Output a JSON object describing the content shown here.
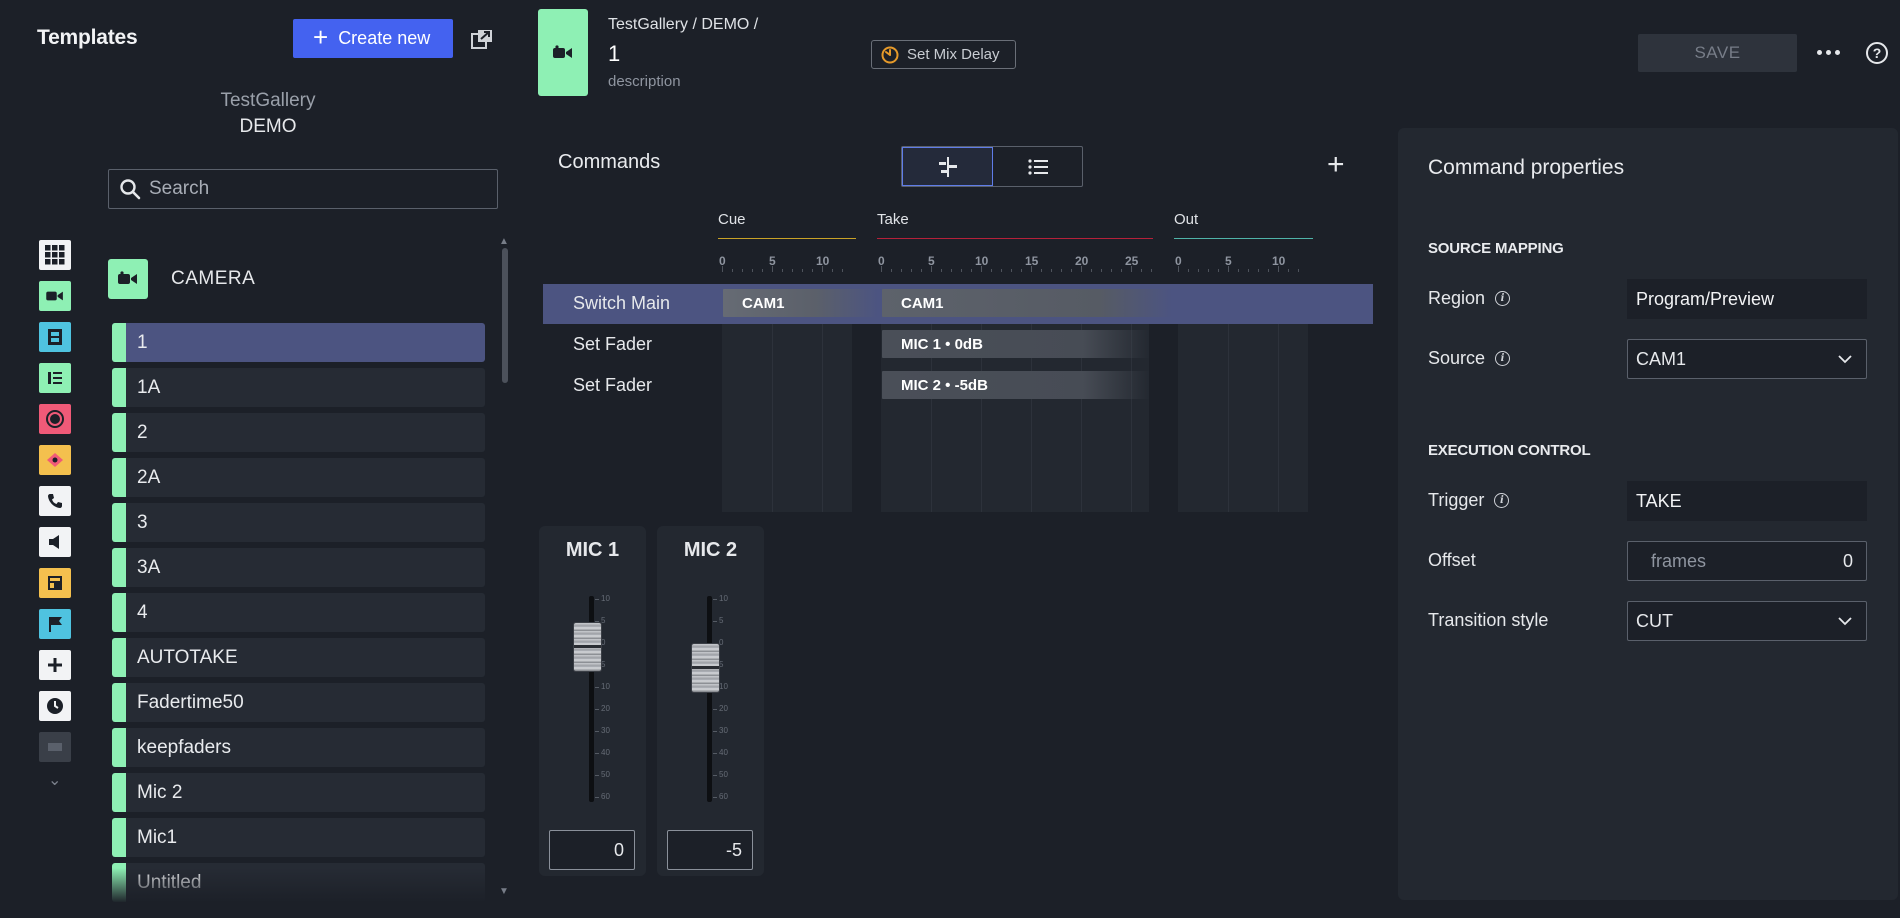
{
  "left": {
    "title": "Templates",
    "create_label": "Create new",
    "gallery_name": "TestGallery",
    "gallery_sub": "DEMO",
    "search_placeholder": "Search",
    "category": "CAMERA",
    "rail_icons": [
      {
        "name": "grid-icon",
        "bg": "#f2f3f5"
      },
      {
        "name": "camera-icon",
        "bg": "#8ef0b4"
      },
      {
        "name": "film-icon",
        "bg": "#4fc3e0"
      },
      {
        "name": "graphics-icon",
        "bg": "#8ef0b4"
      },
      {
        "name": "record-icon",
        "bg": "#f05a78"
      },
      {
        "name": "gamepad-icon",
        "bg": "#f4c04e"
      },
      {
        "name": "phone-icon",
        "bg": "#f2f3f5"
      },
      {
        "name": "speaker-icon",
        "bg": "#f2f3f5"
      },
      {
        "name": "layout-icon",
        "bg": "#f4c04e"
      },
      {
        "name": "flag-icon",
        "bg": "#4fc3e0"
      },
      {
        "name": "add-icon",
        "bg": "#f2f3f5"
      },
      {
        "name": "clock-icon",
        "bg": "#f2f3f5"
      },
      {
        "name": "more-rail-icon",
        "bg": "#3a3f48"
      }
    ],
    "templates": [
      "1",
      "1A",
      "2",
      "2A",
      "3",
      "3A",
      "4",
      "AUTOTAKE",
      "Fadertime50",
      "keepfaders",
      "Mic 2",
      "Mic1",
      "Untitled"
    ],
    "selected_index": 0
  },
  "header": {
    "path": "TestGallery / DEMO /",
    "name": "1",
    "description": "description",
    "mix_delay_label": "Set Mix Delay",
    "save_label": "SAVE"
  },
  "commands": {
    "title": "Commands",
    "phases": {
      "cue": "Cue",
      "take": "Take",
      "out": "Out"
    },
    "colors": {
      "cue": "#c9a227",
      "take": "#b5213a",
      "out": "#4fb3a8"
    },
    "ruler": {
      "cue": [
        "0",
        "5",
        "10"
      ],
      "take": [
        "0",
        "5",
        "10",
        "15",
        "20",
        "25"
      ],
      "out": [
        "0",
        "5",
        "10"
      ]
    },
    "rows": [
      {
        "label": "Switch Main",
        "cue": "CAM1",
        "take": "CAM1"
      },
      {
        "label": "Set Fader",
        "cue": "",
        "take": "MIC 1 • 0dB"
      },
      {
        "label": "Set Fader",
        "cue": "",
        "take": "MIC 2 • -5dB"
      }
    ]
  },
  "faders": [
    {
      "name": "MIC 1",
      "value": "0",
      "level": 0.2
    },
    {
      "name": "MIC 2",
      "value": "-5",
      "level": 0.3
    }
  ],
  "fader_scale": [
    "10",
    "5",
    "0",
    "5",
    "10",
    "20",
    "30",
    "40",
    "50",
    "60"
  ],
  "props": {
    "title": "Command properties",
    "source_mapping": "SOURCE MAPPING",
    "region_label": "Region",
    "region_value": "Program/Preview",
    "source_label": "Source",
    "source_value": "CAM1",
    "execution_control": "EXECUTION CONTROL",
    "trigger_label": "Trigger",
    "trigger_value": "TAKE",
    "offset_label": "Offset",
    "offset_unit": "frames",
    "offset_value": "0",
    "transition_label": "Transition style",
    "transition_value": "CUT"
  }
}
